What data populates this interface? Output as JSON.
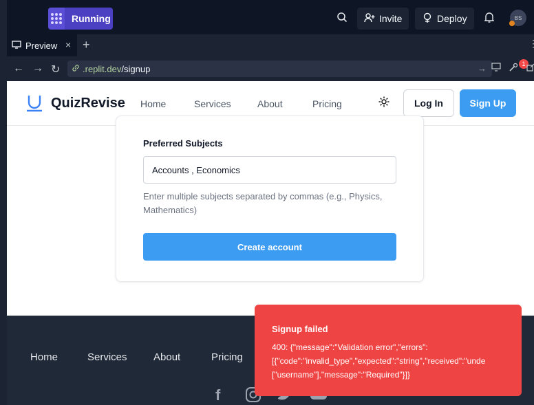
{
  "replit": {
    "run_label": "Running",
    "invite_label": "Invite",
    "deploy_label": "Deploy",
    "avatar_initials": "BS",
    "tab_label": "Preview",
    "url_host": ".replit.dev",
    "url_path": "/signup",
    "badge_count": "1"
  },
  "site": {
    "brand": "QuizRevise",
    "nav": [
      "Home",
      "Services",
      "About",
      "Pricing"
    ],
    "login_label": "Log In",
    "signup_label": "Sign Up"
  },
  "form": {
    "subjects_label": "Preferred Subjects",
    "subjects_value": "Accounts , Economics",
    "subjects_help": "Enter multiple subjects separated by commas (e.g., Physics, Mathematics)",
    "submit_label": "Create account"
  },
  "footer": {
    "links": [
      "Home",
      "Services",
      "About",
      "Pricing"
    ]
  },
  "toast": {
    "title": "Signup failed",
    "body": "400: {\"message\":\"Validation error\",\"errors\":\n[{\"code\":\"invalid_type\",\"expected\":\"string\",\"received\":\"unde\n[\"username\"],\"message\":\"Required\"}]}"
  },
  "colors": {
    "accent": "#3b9cf2",
    "toast_bg": "#ef4444",
    "replit_run": "#4b3fc2",
    "footer_bg": "#202938"
  }
}
